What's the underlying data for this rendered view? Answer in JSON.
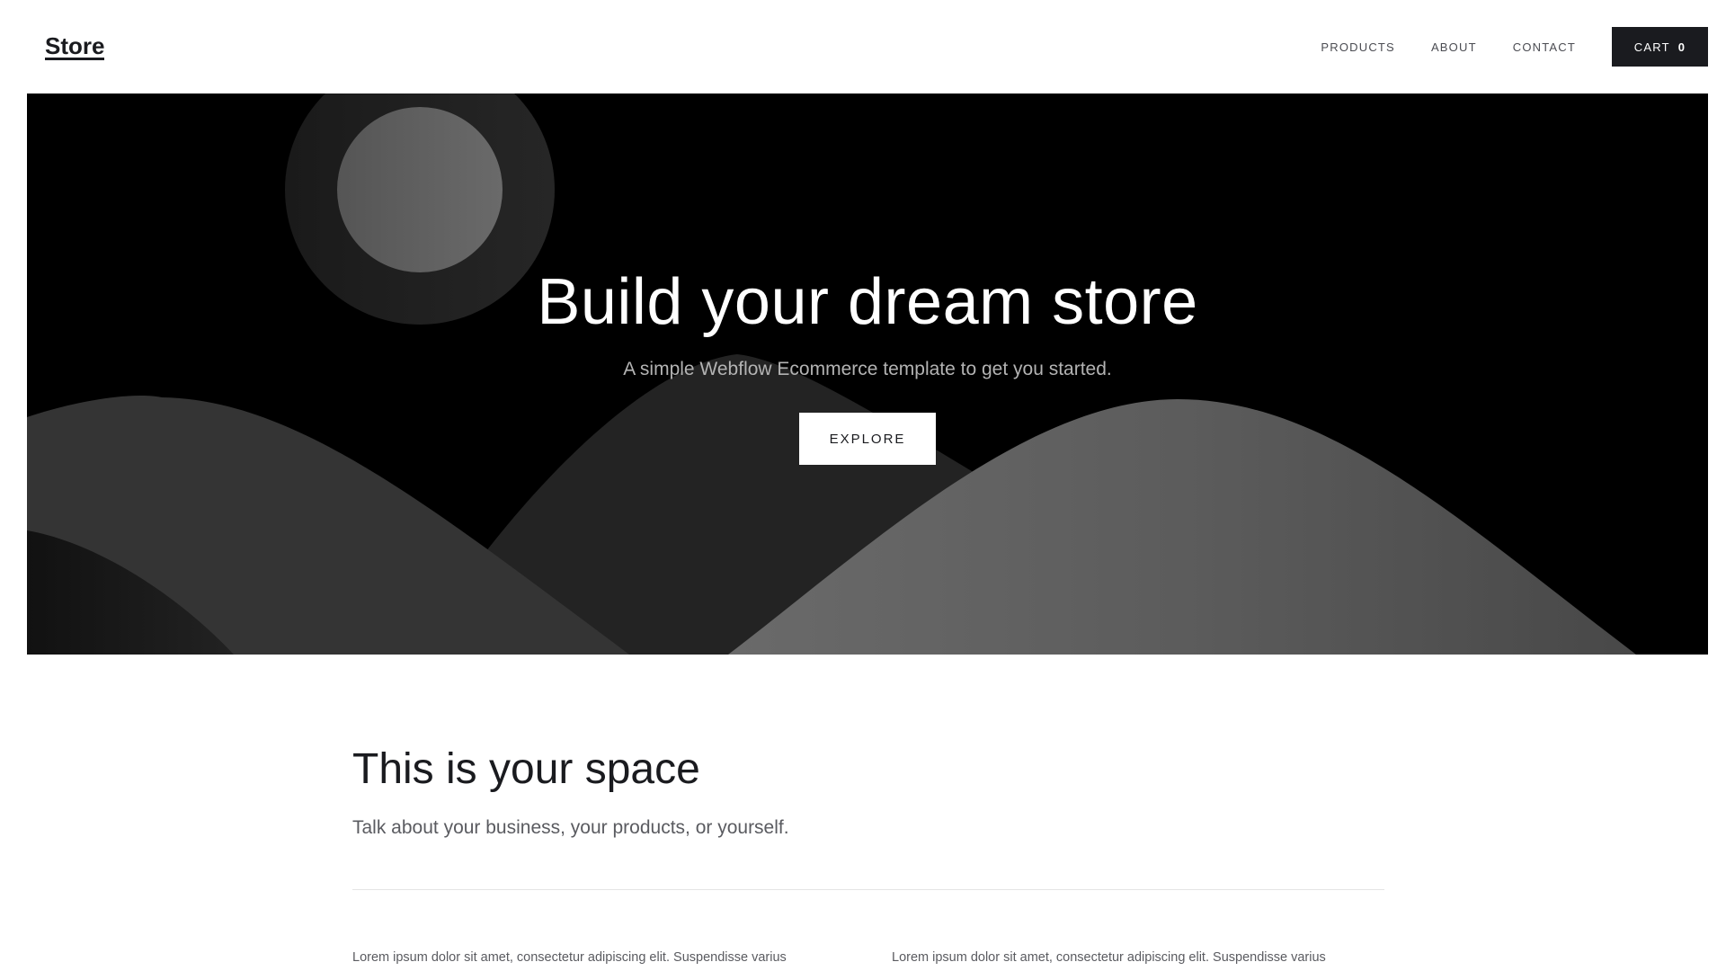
{
  "header": {
    "brand": "Store",
    "nav": [
      {
        "label": "PRODUCTS"
      },
      {
        "label": "ABOUT"
      },
      {
        "label": "CONTACT"
      }
    ],
    "cart": {
      "label": "CART",
      "count": "0"
    }
  },
  "hero": {
    "title": "Build your dream store",
    "subtitle": "A simple Webflow Ecommerce template to get you started.",
    "button": "EXPLORE"
  },
  "section": {
    "title": "This is your space",
    "subtitle": "Talk about your business, your products, or yourself.",
    "columns": [
      {
        "text": "Lorem ipsum dolor sit amet, consectetur adipiscing elit. Suspendisse varius"
      },
      {
        "text": "Lorem ipsum dolor sit amet, consectetur adipiscing elit. Suspendisse varius"
      }
    ]
  },
  "colors": {
    "ink": "#1a1b1f",
    "hero_bg": "#000000",
    "muted": "#5a5b60"
  }
}
